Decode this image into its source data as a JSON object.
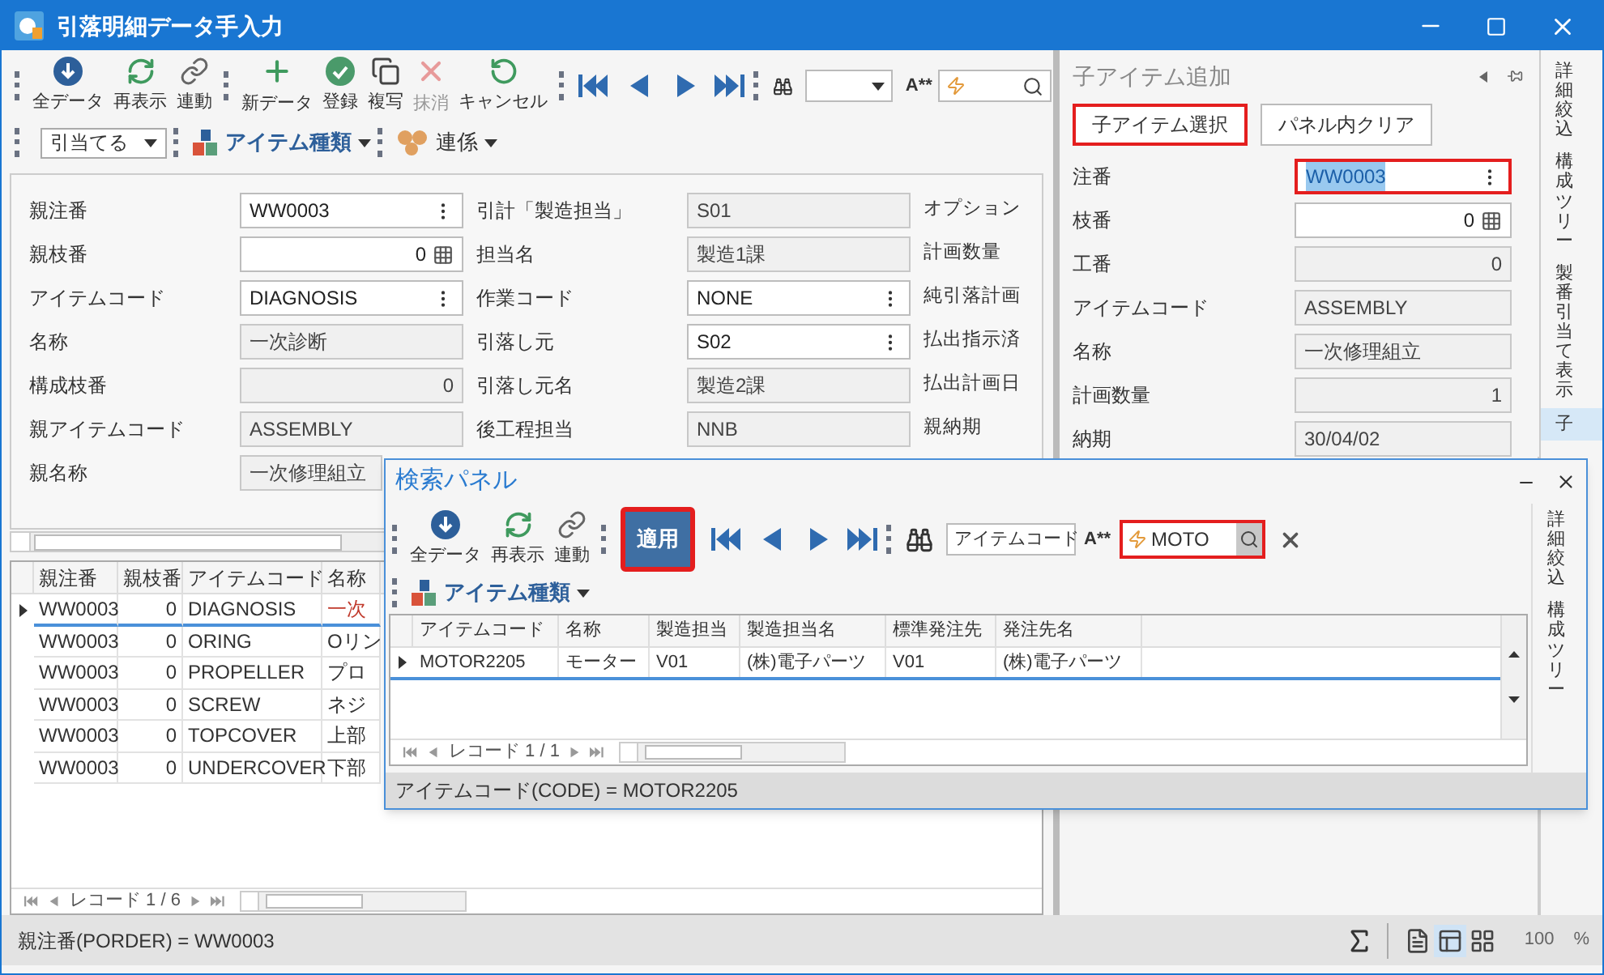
{
  "window": {
    "title": "引落明細データ手入力"
  },
  "toolbar": {
    "groups": [
      {
        "buttons": [
          {
            "label": "全データ",
            "disabled": false
          },
          {
            "label": "再表示",
            "disabled": false
          },
          {
            "label": "連動",
            "disabled": false
          }
        ]
      },
      {
        "buttons": [
          {
            "label": "新データ",
            "disabled": false
          },
          {
            "label": "登録",
            "disabled": false
          },
          {
            "label": "複写",
            "disabled": false
          },
          {
            "label": "抹消",
            "disabled": true
          },
          {
            "label": "キャンセル",
            "disabled": false
          }
        ]
      }
    ],
    "wildcard": "A**"
  },
  "filter_bar": {
    "mode": "引当てる",
    "item_type": "アイテム種類",
    "relation": "連係"
  },
  "form": {
    "columns": [
      [
        {
          "label": "親注番",
          "value": "WW0003",
          "kind": "lookup"
        },
        {
          "label": "親枝番",
          "value": "0",
          "kind": "spin"
        },
        {
          "label": "アイテムコード",
          "value": "DIAGNOSIS",
          "kind": "lookup"
        },
        {
          "label": "名称",
          "value": "一次診断",
          "kind": "readonly"
        },
        {
          "label": "構成枝番",
          "value": "0",
          "kind": "readonly_number"
        },
        {
          "label": "親アイテムコード",
          "value": "ASSEMBLY",
          "kind": "readonly"
        },
        {
          "label": "親名称",
          "value": "一次修理組立",
          "kind": "readonly"
        }
      ],
      [
        {
          "label": "引計「製造担当」",
          "value": "S01",
          "kind": "readonly"
        },
        {
          "label": "担当名",
          "value": "製造1課",
          "kind": "readonly"
        },
        {
          "label": "作業コード",
          "value": "NONE",
          "kind": "lookup"
        },
        {
          "label": "引落し元",
          "value": "S02",
          "kind": "lookup"
        },
        {
          "label": "引落し元名",
          "value": "製造2課",
          "kind": "readonly"
        },
        {
          "label": "後工程担当",
          "value": "NNB",
          "kind": "readonly"
        }
      ],
      [
        {
          "label": "オプション"
        },
        {
          "label": "計画数量"
        },
        {
          "label": "純引落計画"
        },
        {
          "label": "払出指示済"
        },
        {
          "label": "払出計画日"
        },
        {
          "label": "親納期"
        }
      ]
    ]
  },
  "grid": {
    "columns": [
      "親注番",
      "親枝番",
      "アイテムコード",
      "名称"
    ],
    "rows": [
      {
        "cells": [
          "WW0003",
          "0",
          "DIAGNOSIS",
          "一次"
        ],
        "selected": true
      },
      {
        "cells": [
          "WW0003",
          "0",
          "ORING",
          "Oリン"
        ],
        "selected": false
      },
      {
        "cells": [
          "WW0003",
          "0",
          "PROPELLER",
          "プロ"
        ],
        "selected": false
      },
      {
        "cells": [
          "WW0003",
          "0",
          "SCREW",
          "ネジ"
        ],
        "selected": false
      },
      {
        "cells": [
          "WW0003",
          "0",
          "TOPCOVER",
          "上部"
        ],
        "selected": false
      },
      {
        "cells": [
          "WW0003",
          "0",
          "UNDERCOVER",
          "下部"
        ],
        "selected": false
      }
    ],
    "pager": "レコード 1 / 6"
  },
  "side_panel": {
    "title": "子アイテム追加",
    "buttons": [
      {
        "label": "子アイテム選択",
        "highlighted": true
      },
      {
        "label": "パネル内クリア",
        "highlighted": false
      }
    ],
    "fields": [
      {
        "label": "注番",
        "value": "WW0003",
        "kind": "lookup",
        "highlighted": true,
        "text_selected": true
      },
      {
        "label": "枝番",
        "value": "0",
        "kind": "spin",
        "highlighted": false,
        "text_selected": false
      },
      {
        "label": "工番",
        "value": "0",
        "kind": "readonly_number",
        "highlighted": false,
        "text_selected": false
      },
      {
        "label": "アイテムコード",
        "value": "ASSEMBLY",
        "kind": "readonly",
        "highlighted": false,
        "text_selected": false
      },
      {
        "label": "名称",
        "value": "一次修理組立",
        "kind": "readonly",
        "highlighted": false,
        "text_selected": false
      },
      {
        "label": "計画数量",
        "value": "1",
        "kind": "readonly_number",
        "highlighted": false,
        "text_selected": false
      },
      {
        "label": "納期",
        "value": "30/04/02",
        "kind": "readonly",
        "highlighted": false,
        "text_selected": false
      }
    ]
  },
  "side_tabs": [
    {
      "label": "詳細絞込",
      "selected": false
    },
    {
      "label": "構成ツリー",
      "selected": false
    },
    {
      "label": "製番引当て表示",
      "selected": false
    },
    {
      "label": "子",
      "selected": true
    }
  ],
  "search_panel": {
    "title": "検索パネル",
    "buttons": [
      {
        "label": "全データ"
      },
      {
        "label": "再表示"
      },
      {
        "label": "連動"
      }
    ],
    "apply": {
      "label": "適用",
      "highlighted": true
    },
    "search": {
      "column": "アイテムコード",
      "wildcard": "A**",
      "value": "MOTO",
      "highlighted": true
    },
    "item_type": "アイテム種類",
    "grid": {
      "columns": [
        "アイテムコード",
        "名称",
        "製造担当",
        "製造担当名",
        "標準発注先",
        "発注先名"
      ],
      "rows": [
        {
          "cells": [
            "MOTOR2205",
            "モーター",
            "V01",
            "(株)電子パーツ",
            "V01",
            "(株)電子パーツ"
          ],
          "selected": true
        }
      ],
      "pager": "レコード 1 / 1"
    },
    "status": "アイテムコード(CODE) = MOTOR2205",
    "side_tabs": [
      {
        "label": "詳細絞込",
        "selected": false
      },
      {
        "label": "構成ツリー",
        "selected": false
      }
    ]
  },
  "status_bar": {
    "text": "親注番(PORDER) = WW0003",
    "zoom": "100",
    "unit": "%",
    "views": [
      {
        "selected": false
      },
      {
        "selected": true
      },
      {
        "selected": false
      }
    ]
  }
}
